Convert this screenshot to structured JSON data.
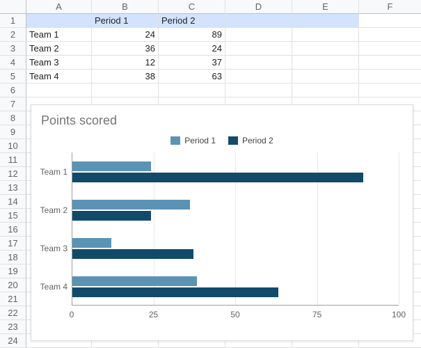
{
  "columns": [
    "A",
    "B",
    "C",
    "D",
    "E",
    "F"
  ],
  "row_count": 24,
  "header_row": {
    "B": "Period 1",
    "C": "Period 2"
  },
  "data_rows": [
    {
      "A": "Team 1",
      "B": "24",
      "C": "89"
    },
    {
      "A": "Team 2",
      "B": "36",
      "C": "24"
    },
    {
      "A": "Team 3",
      "B": "12",
      "C": "37"
    },
    {
      "A": "Team 4",
      "B": "38",
      "C": "63"
    }
  ],
  "selection": {
    "row": 1,
    "cols": [
      "A",
      "B",
      "C",
      "D",
      "E"
    ]
  },
  "chart_data": {
    "type": "bar",
    "orientation": "horizontal",
    "title": "Points scored",
    "categories": [
      "Team 1",
      "Team 2",
      "Team 3",
      "Team 4"
    ],
    "series": [
      {
        "name": "Period 1",
        "values": [
          24,
          36,
          12,
          38
        ],
        "color": "#5b93b5"
      },
      {
        "name": "Period 2",
        "values": [
          89,
          24,
          37,
          63
        ],
        "color": "#124a6a"
      }
    ],
    "xlim": [
      0,
      100
    ],
    "xticks": [
      0,
      25,
      50,
      75,
      100
    ],
    "xlabel": "",
    "ylabel": "",
    "legend_position": "top"
  }
}
